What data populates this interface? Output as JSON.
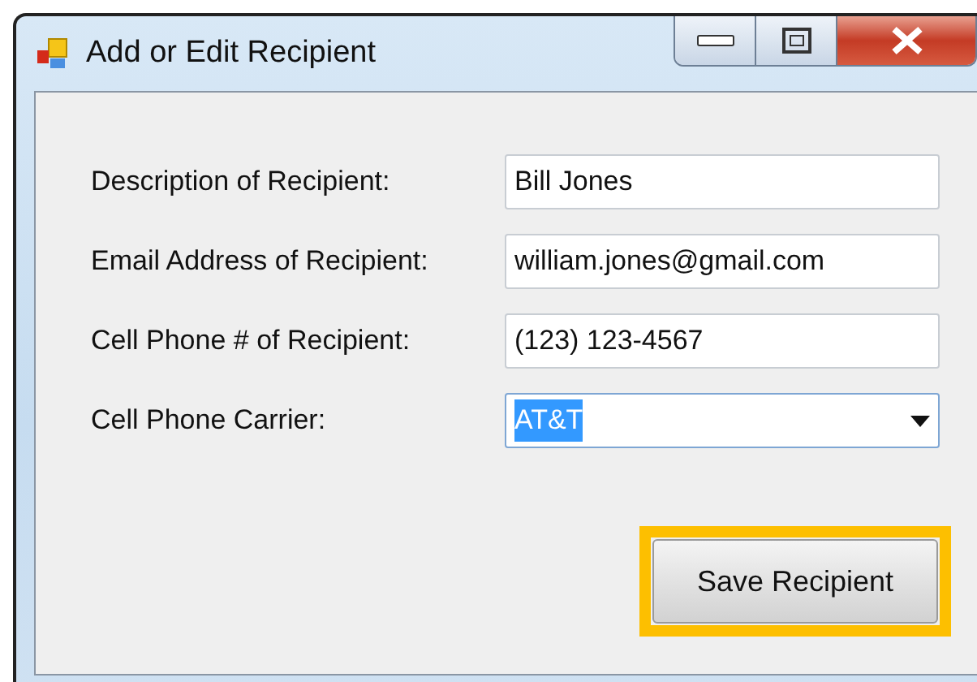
{
  "window": {
    "title": "Add or Edit Recipient"
  },
  "fields": [
    {
      "label": "Description of Recipient:",
      "kind": "text",
      "value": "Bill Jones"
    },
    {
      "label": "Email Address of Recipient:",
      "kind": "text",
      "value": "william.jones@gmail.com"
    },
    {
      "label": "Cell Phone # of Recipient:",
      "kind": "text",
      "value": "(123) 123-4567"
    },
    {
      "label": "Cell Phone Carrier:",
      "kind": "select",
      "value": "AT&T"
    }
  ],
  "save_button": {
    "label": "Save Recipient",
    "highlighted": true
  }
}
